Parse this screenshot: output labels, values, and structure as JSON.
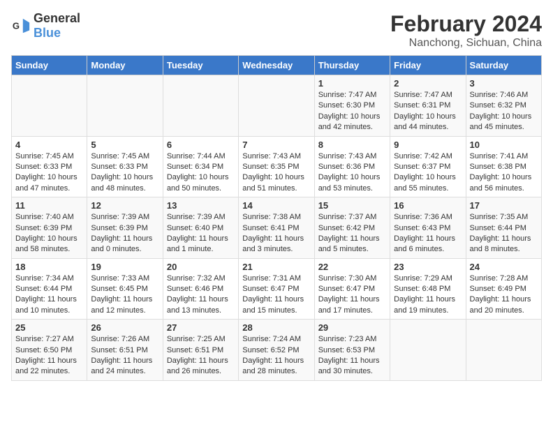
{
  "logo": {
    "general": "General",
    "blue": "Blue"
  },
  "title": "February 2024",
  "subtitle": "Nanchong, Sichuan, China",
  "days_of_week": [
    "Sunday",
    "Monday",
    "Tuesday",
    "Wednesday",
    "Thursday",
    "Friday",
    "Saturday"
  ],
  "weeks": [
    [
      {
        "day": "",
        "info": ""
      },
      {
        "day": "",
        "info": ""
      },
      {
        "day": "",
        "info": ""
      },
      {
        "day": "",
        "info": ""
      },
      {
        "day": "1",
        "info": "Sunrise: 7:47 AM\nSunset: 6:30 PM\nDaylight: 10 hours\nand 42 minutes."
      },
      {
        "day": "2",
        "info": "Sunrise: 7:47 AM\nSunset: 6:31 PM\nDaylight: 10 hours\nand 44 minutes."
      },
      {
        "day": "3",
        "info": "Sunrise: 7:46 AM\nSunset: 6:32 PM\nDaylight: 10 hours\nand 45 minutes."
      }
    ],
    [
      {
        "day": "4",
        "info": "Sunrise: 7:45 AM\nSunset: 6:33 PM\nDaylight: 10 hours\nand 47 minutes."
      },
      {
        "day": "5",
        "info": "Sunrise: 7:45 AM\nSunset: 6:33 PM\nDaylight: 10 hours\nand 48 minutes."
      },
      {
        "day": "6",
        "info": "Sunrise: 7:44 AM\nSunset: 6:34 PM\nDaylight: 10 hours\nand 50 minutes."
      },
      {
        "day": "7",
        "info": "Sunrise: 7:43 AM\nSunset: 6:35 PM\nDaylight: 10 hours\nand 51 minutes."
      },
      {
        "day": "8",
        "info": "Sunrise: 7:43 AM\nSunset: 6:36 PM\nDaylight: 10 hours\nand 53 minutes."
      },
      {
        "day": "9",
        "info": "Sunrise: 7:42 AM\nSunset: 6:37 PM\nDaylight: 10 hours\nand 55 minutes."
      },
      {
        "day": "10",
        "info": "Sunrise: 7:41 AM\nSunset: 6:38 PM\nDaylight: 10 hours\nand 56 minutes."
      }
    ],
    [
      {
        "day": "11",
        "info": "Sunrise: 7:40 AM\nSunset: 6:39 PM\nDaylight: 10 hours\nand 58 minutes."
      },
      {
        "day": "12",
        "info": "Sunrise: 7:39 AM\nSunset: 6:39 PM\nDaylight: 11 hours\nand 0 minutes."
      },
      {
        "day": "13",
        "info": "Sunrise: 7:39 AM\nSunset: 6:40 PM\nDaylight: 11 hours\nand 1 minute."
      },
      {
        "day": "14",
        "info": "Sunrise: 7:38 AM\nSunset: 6:41 PM\nDaylight: 11 hours\nand 3 minutes."
      },
      {
        "day": "15",
        "info": "Sunrise: 7:37 AM\nSunset: 6:42 PM\nDaylight: 11 hours\nand 5 minutes."
      },
      {
        "day": "16",
        "info": "Sunrise: 7:36 AM\nSunset: 6:43 PM\nDaylight: 11 hours\nand 6 minutes."
      },
      {
        "day": "17",
        "info": "Sunrise: 7:35 AM\nSunset: 6:44 PM\nDaylight: 11 hours\nand 8 minutes."
      }
    ],
    [
      {
        "day": "18",
        "info": "Sunrise: 7:34 AM\nSunset: 6:44 PM\nDaylight: 11 hours\nand 10 minutes."
      },
      {
        "day": "19",
        "info": "Sunrise: 7:33 AM\nSunset: 6:45 PM\nDaylight: 11 hours\nand 12 minutes."
      },
      {
        "day": "20",
        "info": "Sunrise: 7:32 AM\nSunset: 6:46 PM\nDaylight: 11 hours\nand 13 minutes."
      },
      {
        "day": "21",
        "info": "Sunrise: 7:31 AM\nSunset: 6:47 PM\nDaylight: 11 hours\nand 15 minutes."
      },
      {
        "day": "22",
        "info": "Sunrise: 7:30 AM\nSunset: 6:47 PM\nDaylight: 11 hours\nand 17 minutes."
      },
      {
        "day": "23",
        "info": "Sunrise: 7:29 AM\nSunset: 6:48 PM\nDaylight: 11 hours\nand 19 minutes."
      },
      {
        "day": "24",
        "info": "Sunrise: 7:28 AM\nSunset: 6:49 PM\nDaylight: 11 hours\nand 20 minutes."
      }
    ],
    [
      {
        "day": "25",
        "info": "Sunrise: 7:27 AM\nSunset: 6:50 PM\nDaylight: 11 hours\nand 22 minutes."
      },
      {
        "day": "26",
        "info": "Sunrise: 7:26 AM\nSunset: 6:51 PM\nDaylight: 11 hours\nand 24 minutes."
      },
      {
        "day": "27",
        "info": "Sunrise: 7:25 AM\nSunset: 6:51 PM\nDaylight: 11 hours\nand 26 minutes."
      },
      {
        "day": "28",
        "info": "Sunrise: 7:24 AM\nSunset: 6:52 PM\nDaylight: 11 hours\nand 28 minutes."
      },
      {
        "day": "29",
        "info": "Sunrise: 7:23 AM\nSunset: 6:53 PM\nDaylight: 11 hours\nand 30 minutes."
      },
      {
        "day": "",
        "info": ""
      },
      {
        "day": "",
        "info": ""
      }
    ]
  ]
}
